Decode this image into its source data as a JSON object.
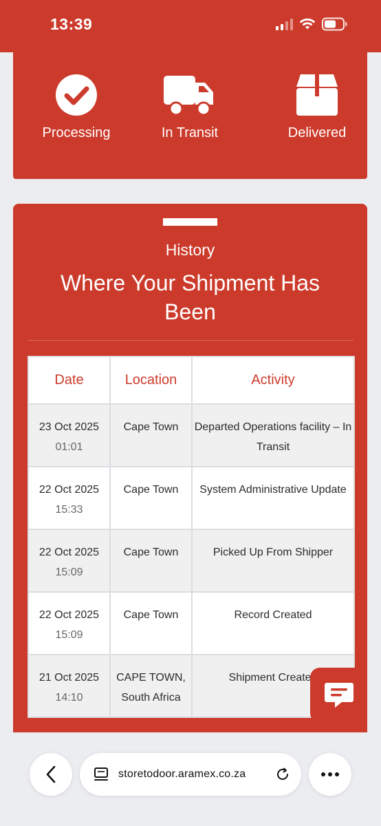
{
  "status_bar": {
    "time": "13:39",
    "icons": [
      "signal-icon",
      "wifi-icon",
      "battery-icon"
    ]
  },
  "tracking_steps": [
    {
      "label": "Processing",
      "icon": "check-circle-icon"
    },
    {
      "label": "In Transit",
      "icon": "truck-icon"
    },
    {
      "label": "Delivered",
      "icon": "box-icon"
    }
  ],
  "history": {
    "subtitle": "History",
    "title": "Where Your Shipment Has Been",
    "columns": {
      "date": "Date",
      "location": "Location",
      "activity": "Activity"
    },
    "rows": [
      {
        "date": "23 Oct 2025",
        "time": "01:01",
        "location": "Cape Town",
        "activity": "Departed Operations facility – In Transit"
      },
      {
        "date": "22 Oct 2025",
        "time": "15:33",
        "location": "Cape Town",
        "activity": "System Administrative Update"
      },
      {
        "date": "22 Oct 2025",
        "time": "15:09",
        "location": "Cape Town",
        "activity": "Picked Up From Shipper"
      },
      {
        "date": "22 Oct 2025",
        "time": "15:09",
        "location": "Cape Town",
        "activity": "Record Created"
      },
      {
        "date": "21 Oct 2025",
        "time": "14:10",
        "location": "CAPE TOWN, South Africa",
        "activity": "Shipment Created"
      }
    ]
  },
  "browser": {
    "url": "storetodoor.aramex.co.za"
  },
  "colors": {
    "brand_red": "#cc3a2b",
    "page_bg": "#ecedf1"
  }
}
